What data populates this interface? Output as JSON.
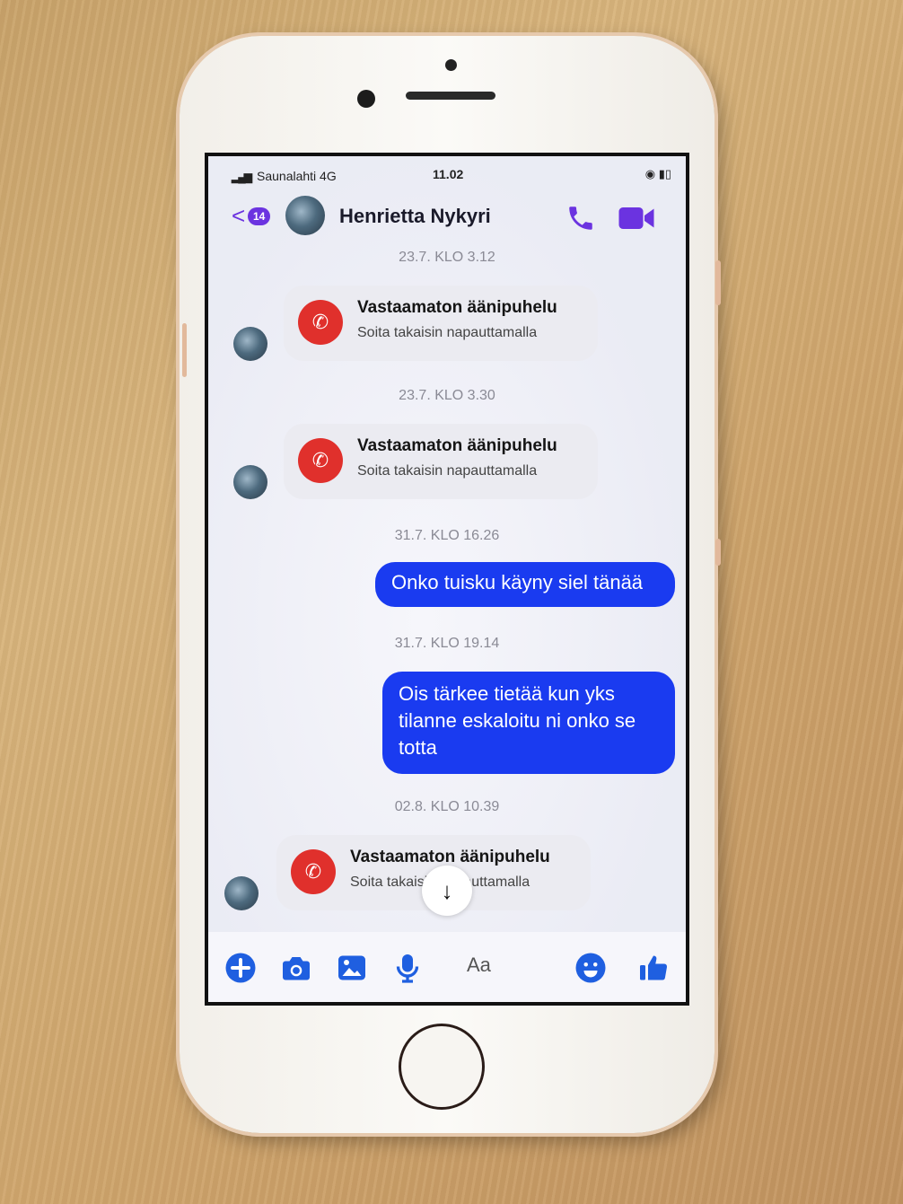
{
  "status_bar": {
    "signal": "▂▄▆",
    "carrier": "Saunalahti  4G",
    "time": "11.02",
    "battery": "◉ ▮▯"
  },
  "header": {
    "back_glyph": "<",
    "unread_badge": "14",
    "contact_name": "Henrietta Nykyri",
    "icons": [
      "phone-icon",
      "video-camera-icon"
    ]
  },
  "messages": [
    {
      "type": "timestamp",
      "text": "23.7. KLO 3.12"
    },
    {
      "type": "missed_call",
      "title": "Vastaamaton äänipuhelu",
      "subtitle": "Soita takaisin napauttamalla"
    },
    {
      "type": "timestamp",
      "text": "23.7. KLO 3.30"
    },
    {
      "type": "missed_call",
      "title": "Vastaamaton äänipuhelu",
      "subtitle": "Soita takaisin napauttamalla"
    },
    {
      "type": "timestamp",
      "text": "31.7. KLO 16.26"
    },
    {
      "type": "outgoing",
      "text": "Onko tuisku käyny siel tänää"
    },
    {
      "type": "timestamp",
      "text": "31.7. KLO 19.14"
    },
    {
      "type": "outgoing",
      "text": "Ois tärkee tietää kun yks tilanne eskaloitu ni onko se totta"
    },
    {
      "type": "timestamp",
      "text": "02.8. KLO 10.39"
    },
    {
      "type": "missed_call",
      "title": "Vastaamaton äänipuhelu",
      "subtitle": "Soita takaisin napauttamalla"
    }
  ],
  "scroll_down_glyph": "↓",
  "missed_call_glyph": "✆",
  "composer": {
    "placeholder": "Aa",
    "icons": [
      "plus-icon",
      "camera-icon",
      "gallery-icon",
      "microphone-icon",
      "emoji-icon",
      "thumbs-up-icon"
    ]
  },
  "colors": {
    "accent": "#6b33e0",
    "bubble": "#1a3bf0",
    "missed_call": "#e0302c",
    "composer_icon": "#1f5fe0"
  }
}
